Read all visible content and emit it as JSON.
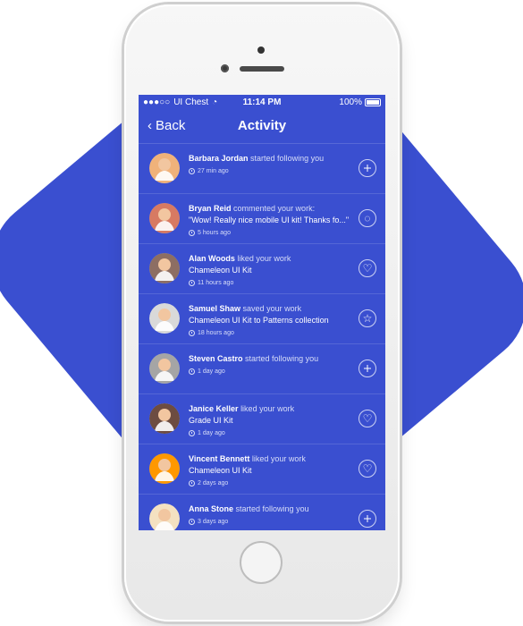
{
  "statusbar": {
    "carrier": "UI Chest",
    "time": "11:14 PM",
    "battery": "100%"
  },
  "navbar": {
    "back_label": "Back",
    "title": "Activity"
  },
  "activity": [
    {
      "name": "Barbara Jordan",
      "action": "started following you",
      "detail": "",
      "time": "27 min ago",
      "button": "plus",
      "avatar_color": "#f0b27a"
    },
    {
      "name": "Bryan Reid",
      "action": "commented your work:",
      "detail": "\"Wow! Really nice mobile UI kit! Thanks fo...\"",
      "time": "5 hours ago",
      "button": "comment",
      "avatar_color": "#d77a62"
    },
    {
      "name": "Alan Woods",
      "action": "liked your work",
      "detail": "Chameleon UI Kit",
      "time": "11 hours ago",
      "button": "heart",
      "avatar_color": "#8d6e63"
    },
    {
      "name": "Samuel Shaw",
      "action": "saved your work",
      "detail": "Chameleon UI Kit  to Patterns collection",
      "time": "18 hours ago",
      "button": "star",
      "avatar_color": "#d9d9d9"
    },
    {
      "name": "Steven Castro",
      "action": "started following you",
      "detail": "",
      "time": "1 day ago",
      "button": "plus",
      "avatar_color": "#a5a5a5"
    },
    {
      "name": "Janice Keller",
      "action": "liked your work",
      "detail": "Grade UI Kit",
      "time": "1 day ago",
      "button": "heart",
      "avatar_color": "#6d4c41"
    },
    {
      "name": "Vincent Bennett",
      "action": "liked your work",
      "detail": "Chameleon UI Kit",
      "time": "2 days ago",
      "button": "heart",
      "avatar_color": "#ff9800"
    },
    {
      "name": "Anna Stone",
      "action": "started following you",
      "detail": "",
      "time": "3 days ago",
      "button": "plus",
      "avatar_color": "#f4e1c1"
    }
  ],
  "colors": {
    "screen_blue": "#3a4fd0",
    "backdrop_blue": "#3a4fd0"
  }
}
